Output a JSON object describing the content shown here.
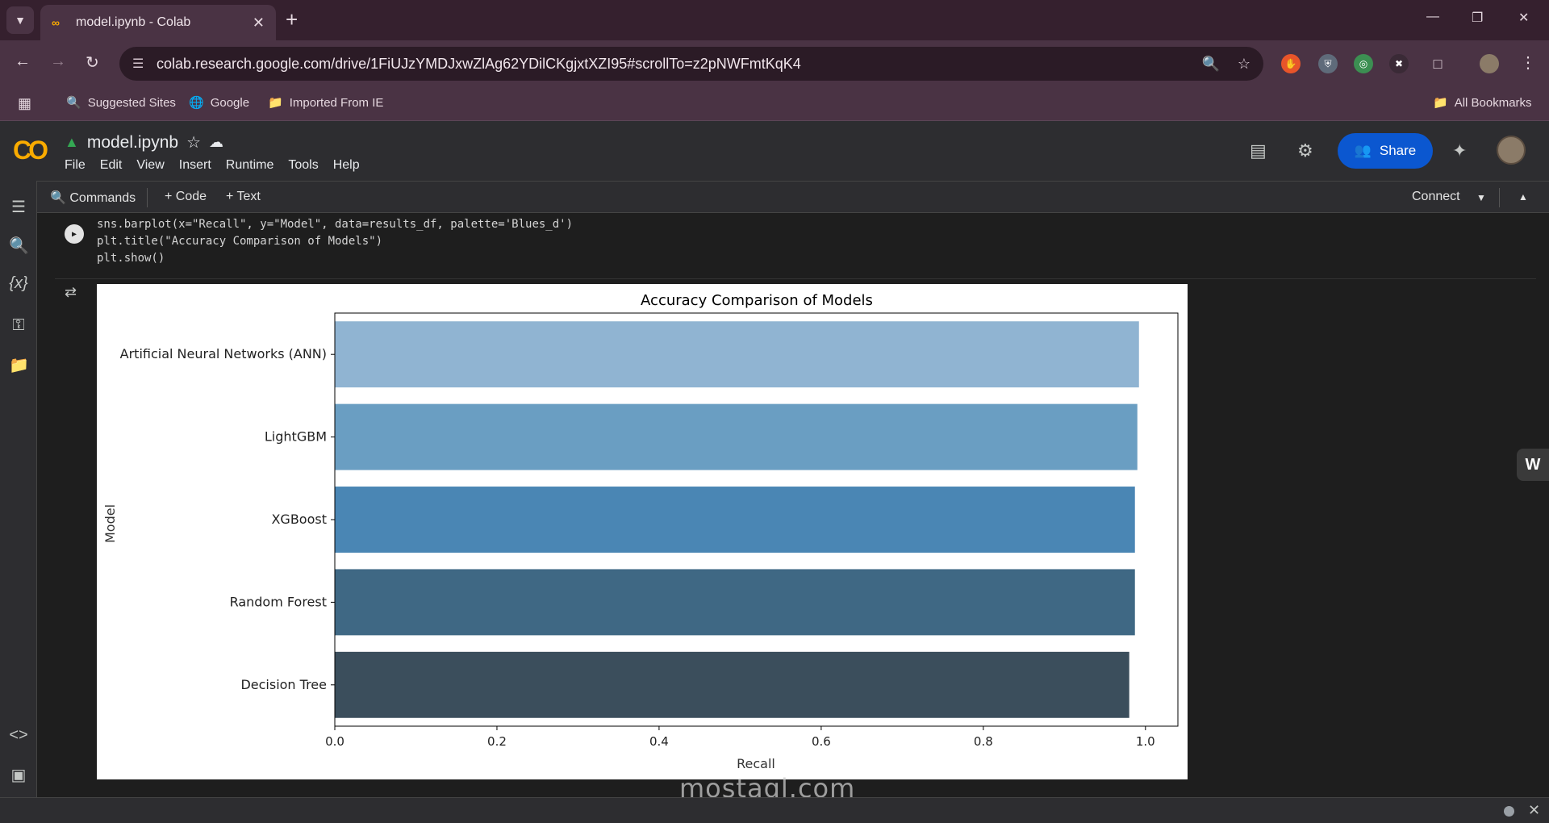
{
  "browser": {
    "tab_title": "model.ipynb - Colab",
    "url": "colab.research.google.com/drive/1FiUJzYMDJxwZlAg62YDilCKgjxtXZI95#scrollTo=z2pNWFmtKqK4",
    "bookmarks": [
      "Suggested Sites",
      "Google",
      "Imported From IE"
    ],
    "all_bookmarks": "All Bookmarks"
  },
  "colab": {
    "logo": "CO",
    "notebook_title": "model.ipynb",
    "menu": [
      "File",
      "Edit",
      "View",
      "Insert",
      "Runtime",
      "Tools",
      "Help"
    ],
    "share_label": "Share",
    "toolbar": {
      "commands": "Commands",
      "code": "+ Code",
      "text": "+ Text",
      "connect": "Connect"
    }
  },
  "cell": {
    "lines": [
      "sns.barplot(x=\"Recall\", y=\"Model\", data=results_df, palette='Blues_d')",
      "plt.title(\"Accuracy Comparison of Models\")",
      "plt.show()"
    ]
  },
  "chart_data": {
    "type": "bar",
    "orientation": "horizontal",
    "title": "Accuracy Comparison of Models",
    "xlabel": "Recall",
    "ylabel": "Model",
    "categories": [
      "Artificial Neural Networks (ANN)",
      "LightGBM",
      "XGBoost",
      "Random Forest",
      "Decision Tree"
    ],
    "values": [
      0.992,
      0.99,
      0.987,
      0.987,
      0.98
    ],
    "xlim": [
      0,
      1.04
    ],
    "xticks": [
      "0.0",
      "0.2",
      "0.4",
      "0.6",
      "0.8",
      "1.0"
    ],
    "colors": [
      "#90b4d2",
      "#6a9ec2",
      "#4a86b4",
      "#3f6884",
      "#3b4e5c"
    ],
    "grid": false
  },
  "watermark": "mostaql.com",
  "icons": {
    "tab_menu": "chevron-down-icon",
    "side": [
      "toc-icon",
      "find-icon",
      "variables-icon",
      "key-icon",
      "folder-icon",
      "code-snippets-icon",
      "terminal-icon"
    ]
  }
}
